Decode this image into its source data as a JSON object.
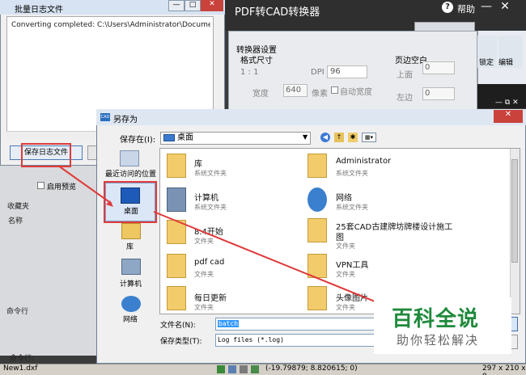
{
  "cad_app": {
    "title": "PDF转CAD转换器",
    "help": "帮助",
    "help_icon": "?",
    "min": "—",
    "close": "✕",
    "ribbon_label_1": "锁定",
    "ribbon_label_2": "编辑",
    "inner_ctrl": "— ⧉ ✕",
    "panel_header": "收藏夹",
    "panel_column": "名称",
    "command_1": "命令行",
    "command_2": "命令行:",
    "preview_label": "启用预览"
  },
  "converter": {
    "settings": "转换器设置",
    "size": "格式尺寸",
    "ratio": "1 : 1",
    "dpi_label": "DPI",
    "dpi_value": "96",
    "width_label": "宽度",
    "width_value": "640",
    "unit": "像素",
    "auto_width": "自动宽度",
    "margin": "页边空白",
    "top_label": "上面",
    "top_value": "0",
    "left_label": "左边",
    "left_value": "0"
  },
  "log_dialog": {
    "title": "批量日志文件",
    "min": "—",
    "max": "□",
    "close": "✕",
    "content": "Converting completed: C:\\Users\\Administrator\\Documents\\CAD",
    "save_button": "保存日志文件"
  },
  "save_dialog": {
    "title": "另存为",
    "app_icon_text": "CAD",
    "close": "✕",
    "save_in_label": "保存在(I):",
    "save_in_value": "桌面",
    "places": [
      {
        "label": "最近访问的位置"
      },
      {
        "label": "桌面"
      },
      {
        "label": "库"
      },
      {
        "label": "计算机"
      },
      {
        "label": "网络"
      }
    ],
    "files": [
      {
        "name": "库",
        "type": "系统文件夹"
      },
      {
        "name": "Administrator",
        "type": "系统文件夹"
      },
      {
        "name": "计算机",
        "type": "系统文件夹"
      },
      {
        "name": "网络",
        "type": "系统文件夹"
      },
      {
        "name": "8.4开始",
        "type": "文件夹"
      },
      {
        "name": "25套CAD古建牌坊牌楼设计施工",
        "name2": "图",
        "type": "文件夹"
      },
      {
        "name": "pdf cad",
        "type": "文件夹"
      },
      {
        "name": "VPN工具",
        "type": "文件夹"
      },
      {
        "name": "每日更新",
        "type": "文件夹"
      },
      {
        "name": "头像图片",
        "type": "文件夹"
      }
    ],
    "filename_label": "文件名(N):",
    "filename_value": "batch",
    "filetype_label": "保存类型(T):",
    "filetype_value": "Log files (*.log)"
  },
  "status_bar": {
    "file": "New1.dxf",
    "coords": "(-19.79879; 8.820615; 0)",
    "size": "297 x 210 x 0."
  },
  "watermark": {
    "title": "百科全说",
    "subtitle": "助你轻松解决"
  },
  "colors": {
    "annotation": "#e03a3a",
    "watermark_green": "#1f8a3b"
  }
}
